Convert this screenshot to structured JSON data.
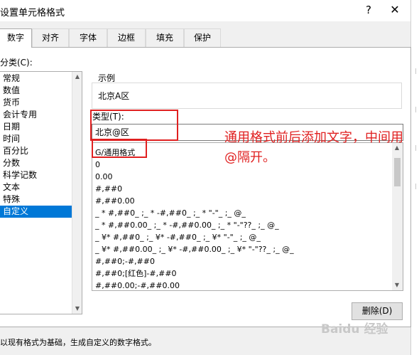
{
  "window": {
    "title": "设置单元格格式",
    "help_label": "?",
    "close_label": "✕"
  },
  "tabs": [
    {
      "label": "数字",
      "active": true
    },
    {
      "label": "对齐",
      "active": false
    },
    {
      "label": "字体",
      "active": false
    },
    {
      "label": "边框",
      "active": false
    },
    {
      "label": "填充",
      "active": false
    },
    {
      "label": "保护",
      "active": false
    }
  ],
  "category": {
    "label": "分类(C):",
    "items": [
      "常规",
      "数值",
      "货币",
      "会计专用",
      "日期",
      "时间",
      "百分比",
      "分数",
      "科学记数",
      "文本",
      "特殊",
      "自定义"
    ],
    "selected": "自定义"
  },
  "sample": {
    "label": "示例",
    "value": "北京A区"
  },
  "type": {
    "label": "类型(T):",
    "value": "北京@区"
  },
  "formats": [
    "G/通用格式",
    "0",
    "0.00",
    "#,##0",
    "#,##0.00",
    "_ * #,##0_ ;_ * -#,##0_ ;_ * \"-\"_ ;_ @_",
    "_ * #,##0.00_ ;_ * -#,##0.00_ ;_ * \"-\"??_ ;_ @_",
    "_ ¥* #,##0_ ;_ ¥* -#,##0_ ;_ ¥* \"-\"_ ;_ @_",
    "_ ¥* #,##0.00_ ;_ ¥* -#,##0.00_ ;_ ¥* \"-\"??_ ;_ @_",
    "#,##0;-#,##0",
    "#,##0;[红色]-#,##0",
    "#,##0.00;-#,##0.00"
  ],
  "delete_label": "删除(D)",
  "footer": "以现有格式为基础，生成自定义的数字格式。",
  "annotation": "通用格式前后添加文字，中间用@隔开。",
  "watermark": "Baidu 经验",
  "colors": {
    "selection": "#0078d7",
    "annotation": "#e02020"
  }
}
